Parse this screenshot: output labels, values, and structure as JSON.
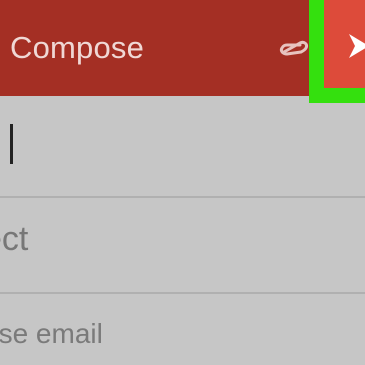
{
  "toolbar": {
    "title": "Compose",
    "attach_icon": "paperclip-icon",
    "send_icon": "send-icon",
    "background_color": "#a42f24",
    "send_button_color": "#dd4b3a",
    "highlight_color": "#34e00e"
  },
  "compose": {
    "subject_text": "ect",
    "body_text": "ose email"
  }
}
